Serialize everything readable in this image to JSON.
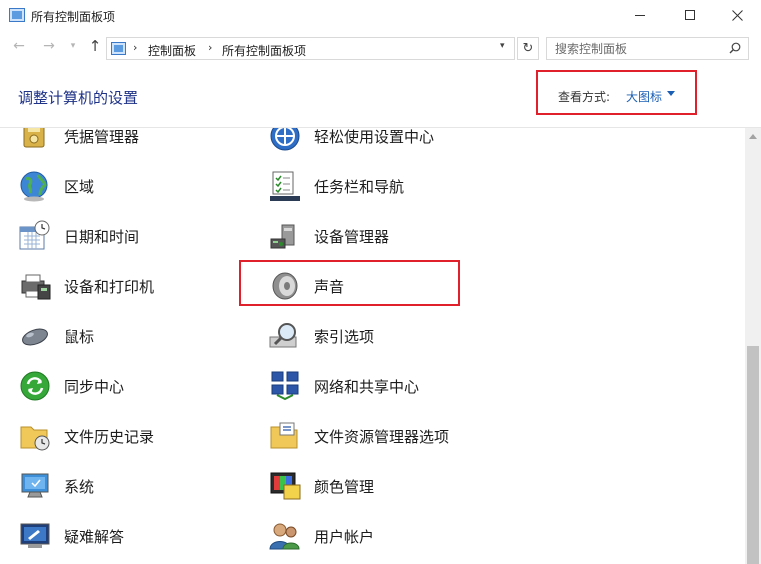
{
  "window": {
    "title": "所有控制面板项",
    "min_icon": "minimize-icon",
    "max_icon": "maximize-icon",
    "close_icon": "close-icon"
  },
  "nav": {
    "back_glyph": "←",
    "forward_glyph": "→",
    "recent_glyph": "⌄",
    "up_glyph": "↑",
    "breadcrumb": [
      "控制面板",
      "所有控制面板项"
    ],
    "breadcrumb_sep": "›",
    "dropdown_glyph": "⌄",
    "refresh_glyph": "↻",
    "search_placeholder": "搜索控制面板"
  },
  "header": {
    "title": "调整计算机的设置",
    "view_label": "查看方式:",
    "view_value": "大图标"
  },
  "items": {
    "credential_manager": "凭据管理器",
    "ease_of_access": "轻松使用设置中心",
    "region": "区域",
    "taskbar": "任务栏和导航",
    "date_time": "日期和时间",
    "device_manager": "设备管理器",
    "devices_printers": "设备和打印机",
    "sound": "声音",
    "mouse": "鼠标",
    "indexing": "索引选项",
    "sync_center": "同步中心",
    "network": "网络和共享中心",
    "file_history": "文件历史记录",
    "file_explorer_options": "文件资源管理器选项",
    "system": "系统",
    "color_management": "颜色管理",
    "troubleshooting": "疑难解答",
    "user_accounts": "用户帐户"
  },
  "colors": {
    "highlight": "#e0202a",
    "title_blue": "#1e3287",
    "link_blue": "#1a5fb4"
  }
}
